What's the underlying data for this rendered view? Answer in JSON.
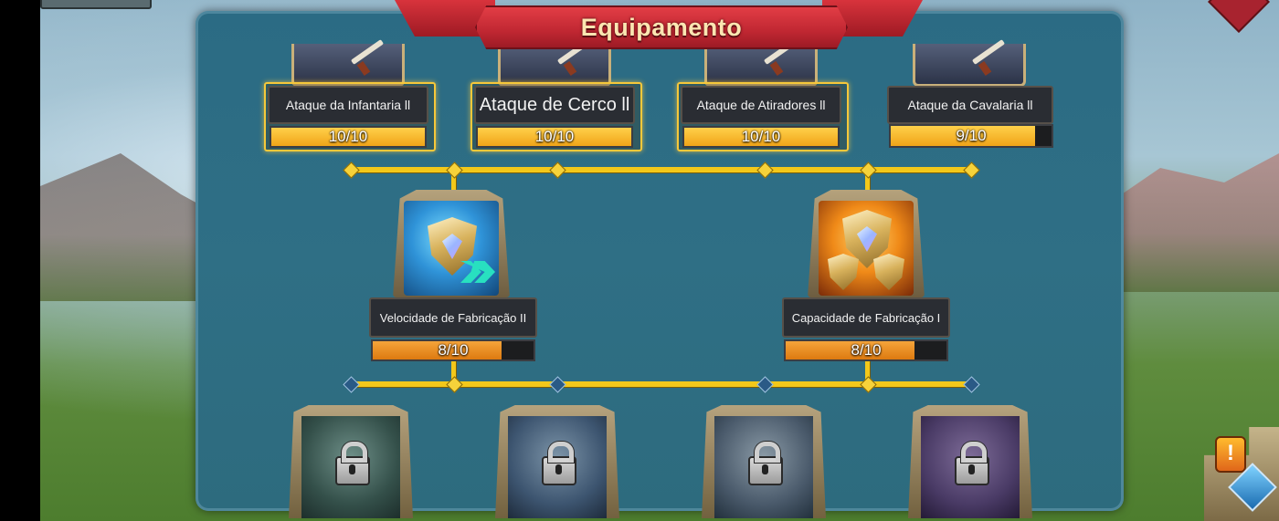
{
  "title": "Equipamento",
  "top_row": [
    {
      "label": "Ataque da Infantaria ll",
      "progress": "10/10",
      "fill": 1.0,
      "highlight": true,
      "large": false
    },
    {
      "label": "Ataque de Cerco ll",
      "progress": "10/10",
      "fill": 1.0,
      "highlight": true,
      "large": true
    },
    {
      "label": "Ataque de Atiradores ll",
      "progress": "10/10",
      "fill": 1.0,
      "highlight": true,
      "large": false
    },
    {
      "label": "Ataque da Cavalaria ll",
      "progress": "9/10",
      "fill": 0.9,
      "highlight": false,
      "large": false
    }
  ],
  "middle_row": [
    {
      "label": "Velocidade de Fabricação II",
      "progress": "8/10",
      "fill": 0.8,
      "icon": "speed-shield-icon"
    },
    {
      "label": "Capacidade de Fabricação I",
      "progress": "8/10",
      "fill": 0.8,
      "icon": "capacity-shields-icon"
    }
  ],
  "bottom_row": [
    {
      "icon": "locked-hero-1-icon",
      "locked": true
    },
    {
      "icon": "locked-hero-2-icon",
      "locked": true
    },
    {
      "icon": "locked-hero-3-icon",
      "locked": true
    },
    {
      "icon": "locked-hero-4-icon",
      "locked": true
    }
  ],
  "corner": {
    "alert_symbol": "!"
  },
  "colors": {
    "connector": "#f3c81a",
    "bar_full": "#ffd04a",
    "bar_partial": "#f5a43a",
    "banner": "#c02732"
  }
}
